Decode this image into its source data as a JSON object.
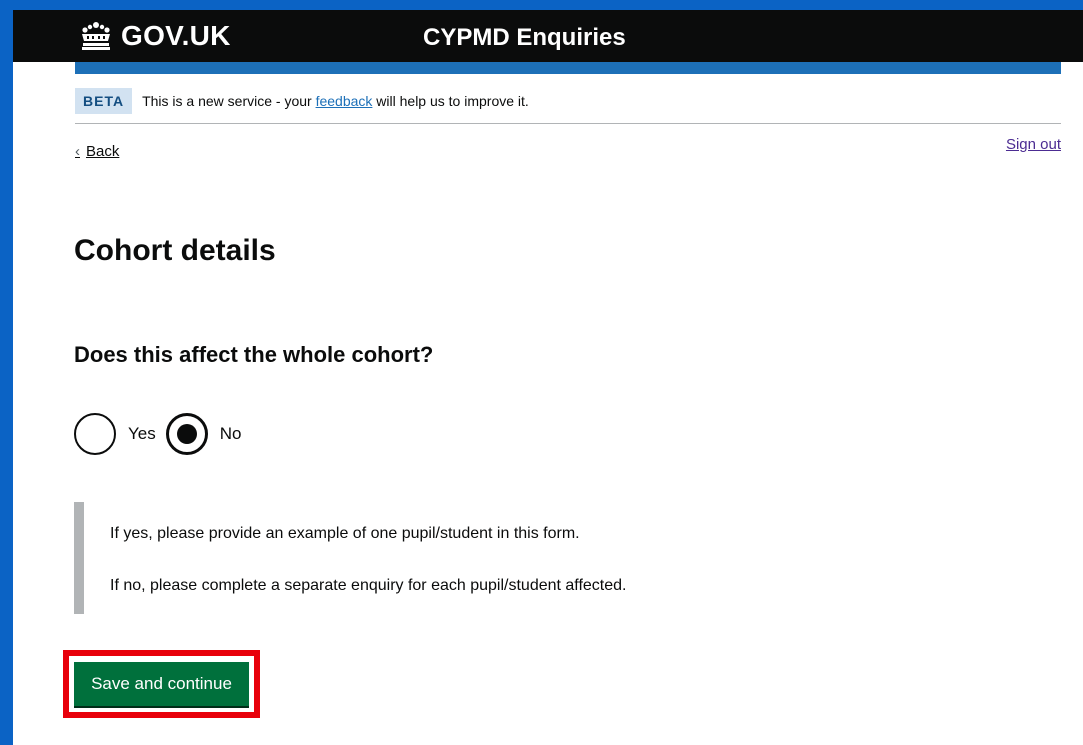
{
  "header": {
    "logo_text": "GOV.UK",
    "service_name": "CYPMD Enquiries"
  },
  "phase_banner": {
    "tag": "BETA",
    "text_before": "This is a new service - your ",
    "link_text": "feedback",
    "text_after": " will help us to improve it."
  },
  "nav": {
    "back": "Back",
    "sign_out": "Sign out"
  },
  "page": {
    "title": "Cohort details",
    "question": "Does this affect the whole cohort?",
    "options": [
      {
        "label": "Yes",
        "selected": false
      },
      {
        "label": "No",
        "selected": true
      }
    ],
    "inset_lines": [
      "If yes, please provide an example of one pupil/student in this form.",
      "If no, please complete a separate enquiry for each pupil/student affected."
    ],
    "save_label": "Save and continue"
  },
  "icons": {
    "logo": "crown-icon",
    "back": "chevron-left-icon"
  },
  "colors": {
    "header_bg": "#0b0c0c",
    "header_bar": "#1d70b8",
    "button_green": "#00703c",
    "highlight_red": "#e8000b",
    "frame_blue": "#0b63c5"
  }
}
